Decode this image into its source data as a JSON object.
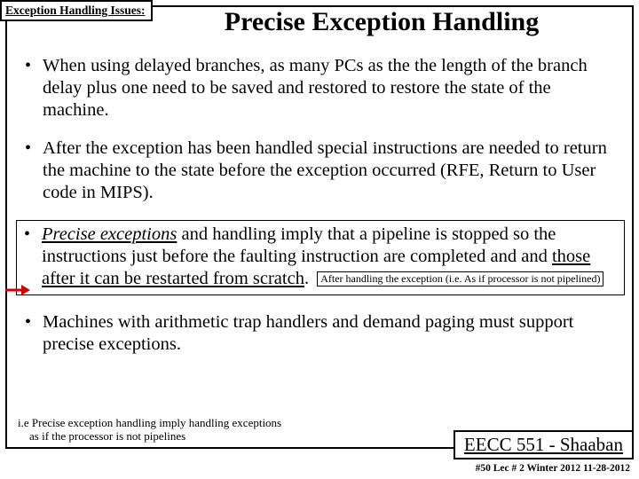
{
  "tag": "Exception Handling Issues:",
  "title": "Precise Exception Handling",
  "bullets": {
    "b1": "When using delayed branches, as many PCs as the the length of the branch delay plus one need to be saved and restored to restore the state of the machine.",
    "b2": "After the exception has been handled special instructions are needed to return the machine to the state before the exception occurred (RFE, Return to User code in MIPS).",
    "b3_lead": "Precise exceptions",
    "b3_mid1": " and handling imply that a pipeline is stopped so the instructions just before the faulting instruction are completed and and ",
    "b3_u2": "those after it can be restarted from scratch",
    "b3_tail": ".",
    "b3_note": "After handling the exception (i.e. As if processor is not pipelined)",
    "b4": "Machines with arithmetic trap handlers and demand paging must support precise exceptions."
  },
  "footnote_l1": "i.e Precise exception handling imply handling  exceptions",
  "footnote_l2": "as if the processor is not pipelines",
  "footer_course": "EECC 551 ",
  "footer_dash": "- ",
  "footer_name": "Shaaban",
  "footer_meta": "#50  Lec # 2  Winter 2012   11-28-2012"
}
